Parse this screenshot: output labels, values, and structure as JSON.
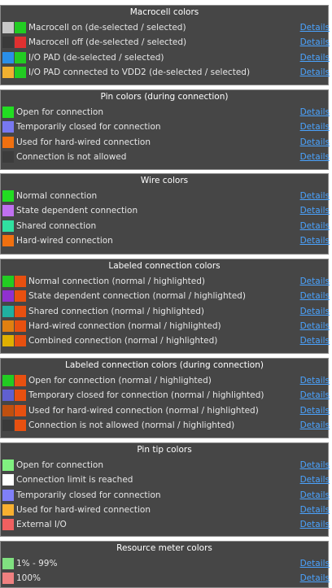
{
  "details_label": "Details",
  "sections": [
    {
      "title": "Macrocell colors",
      "items": [
        {
          "label": "Macrocell on (de-selected / selected)",
          "swatches": [
            "#c8c8c8",
            "#22cc22"
          ]
        },
        {
          "label": "Macrocell off (de-selected / selected)",
          "swatches": [
            "#3a3a3a",
            "#e03030"
          ]
        },
        {
          "label": "I/O PAD (de-selected / selected)",
          "swatches": [
            "#2a8fe8",
            "#22cc22"
          ]
        },
        {
          "label": "I/O PAD connected to VDD2 (de-selected / selected)",
          "swatches": [
            "#f0b030",
            "#22cc22"
          ]
        }
      ]
    },
    {
      "title": "Pin colors (during connection)",
      "items": [
        {
          "label": "Open for connection",
          "swatches": [
            "#22dd22"
          ]
        },
        {
          "label": "Temporarily closed for connection",
          "swatches": [
            "#7878f0"
          ]
        },
        {
          "label": "Used for hard-wired connection",
          "swatches": [
            "#f07010"
          ]
        },
        {
          "label": "Connection is not allowed",
          "swatches": [
            "#3c3c3c"
          ]
        }
      ]
    },
    {
      "title": "Wire colors",
      "items": [
        {
          "label": "Normal connection",
          "swatches": [
            "#22dd22"
          ]
        },
        {
          "label": "State dependent connection",
          "swatches": [
            "#c070f0"
          ]
        },
        {
          "label": "Shared connection",
          "swatches": [
            "#30e0a0"
          ]
        },
        {
          "label": "Hard-wired connection",
          "swatches": [
            "#f07010"
          ]
        }
      ]
    },
    {
      "title": "Labeled connection colors",
      "items": [
        {
          "label": "Normal connection (normal / highlighted)",
          "swatches": [
            "#22cc22",
            "#e85010"
          ]
        },
        {
          "label": "State dependent connection (normal / highlighted)",
          "swatches": [
            "#9030d0",
            "#e85010"
          ]
        },
        {
          "label": "Shared connection (normal / highlighted)",
          "swatches": [
            "#20b0a0",
            "#e85010"
          ]
        },
        {
          "label": "Hard-wired connection (normal / highlighted)",
          "swatches": [
            "#e08010",
            "#e85010"
          ]
        },
        {
          "label": "Combined connection (normal / highlighted)",
          "swatches": [
            "#e0b000",
            "#e85010"
          ]
        }
      ]
    },
    {
      "title": "Labeled connection colors (during connection)",
      "items": [
        {
          "label": "Open for connection (normal / highlighted)",
          "swatches": [
            "#22cc22",
            "#e85010"
          ]
        },
        {
          "label": "Temporary closed for connection (normal / highlighted)",
          "swatches": [
            "#6060d0",
            "#e85010"
          ]
        },
        {
          "label": "Used for hard-wired connection (normal / highlighted)",
          "swatches": [
            "#c05010",
            "#e85010"
          ]
        },
        {
          "label": "Connection is not allowed (normal / highlighted)",
          "swatches": [
            "#3a3a3a",
            "#e85010"
          ]
        }
      ]
    },
    {
      "title": "Pin tip colors",
      "items": [
        {
          "label": "Open for connection",
          "swatches": [
            "#80f080"
          ]
        },
        {
          "label": "Connection limit is reached",
          "swatches": [
            "#ffffff"
          ]
        },
        {
          "label": "Temporarily closed for connection",
          "swatches": [
            "#8080f8"
          ]
        },
        {
          "label": "Used for hard-wired connection",
          "swatches": [
            "#f8b030"
          ]
        },
        {
          "label": "External I/O",
          "swatches": [
            "#f06060"
          ]
        }
      ]
    },
    {
      "title": "Resource meter colors",
      "items": [
        {
          "label": "1% - 99%",
          "swatches": [
            "#80e080"
          ]
        },
        {
          "label": "100%",
          "swatches": [
            "#f08080"
          ]
        }
      ]
    }
  ]
}
